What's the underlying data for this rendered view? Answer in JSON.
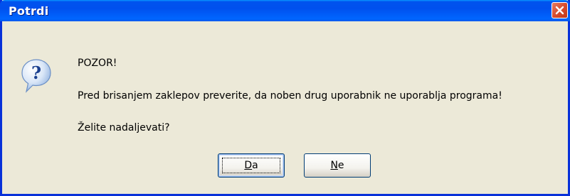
{
  "window": {
    "title": "Potrdi"
  },
  "icons": {
    "dialog_icon": "question-icon",
    "close": "close-icon"
  },
  "message": {
    "line1": "POZOR!",
    "line2": "Pred brisanjem zaklepov preverite, da noben drug uporabnik ne uporablja programa!",
    "line3": "Želite nadaljevati?"
  },
  "buttons": {
    "yes_mnemonic": "D",
    "yes_rest": "a",
    "no_mnemonic": "N",
    "no_rest": "e"
  },
  "colors": {
    "titlebar": "#0053ee",
    "dialog_bg": "#ece9d8",
    "close": "#d84d2f"
  }
}
